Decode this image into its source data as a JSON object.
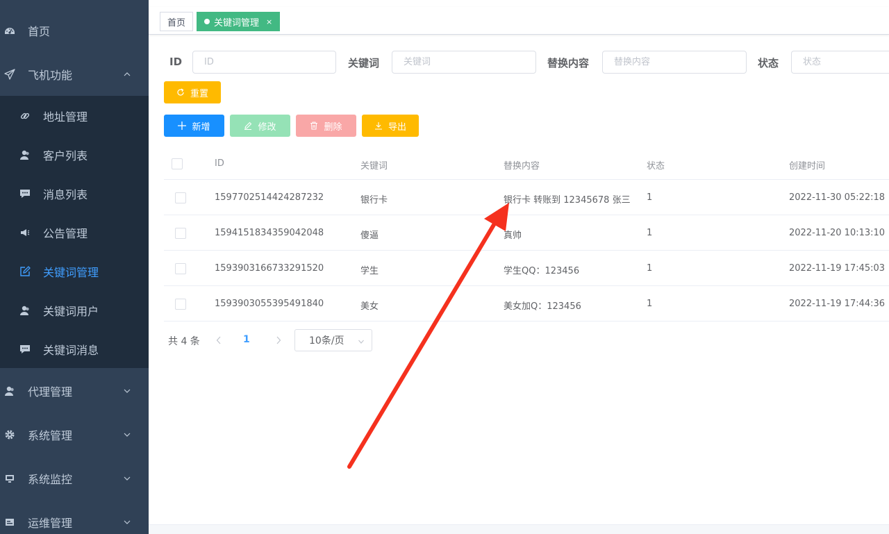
{
  "sidebar": {
    "top_items": [
      {
        "label": "首页",
        "icon": "dashboard-icon"
      },
      {
        "label": "飞机功能",
        "icon": "paper-plane-icon",
        "expanded": true
      },
      {
        "label": "代理管理",
        "icon": "user-icon"
      },
      {
        "label": "系统管理",
        "icon": "gear-icon"
      },
      {
        "label": "系统监控",
        "icon": "monitor-icon"
      },
      {
        "label": "运维管理",
        "icon": "tool-icon"
      }
    ],
    "sub_items": [
      {
        "label": "地址管理",
        "icon": "link-icon"
      },
      {
        "label": "客户列表",
        "icon": "user-icon"
      },
      {
        "label": "消息列表",
        "icon": "message-icon"
      },
      {
        "label": "公告管理",
        "icon": "megaphone-icon"
      },
      {
        "label": "关键词管理",
        "icon": "edit-icon",
        "active": true
      },
      {
        "label": "关键词用户",
        "icon": "user-icon"
      },
      {
        "label": "关键词消息",
        "icon": "message-icon"
      }
    ]
  },
  "tags": [
    {
      "label": "首页",
      "active": false
    },
    {
      "label": "关键词管理",
      "active": true,
      "close": "×"
    }
  ],
  "search": {
    "fields": [
      {
        "label": "ID",
        "placeholder": "ID"
      },
      {
        "label": "关键词",
        "placeholder": "关键词"
      },
      {
        "label": "替换内容",
        "placeholder": "替换内容"
      },
      {
        "label": "状态",
        "placeholder": "状态"
      }
    ],
    "reset_label": "重置"
  },
  "toolbar": {
    "add_label": "新增",
    "edit_label": "修改",
    "delete_label": "删除",
    "export_label": "导出"
  },
  "table": {
    "columns": [
      "ID",
      "关键词",
      "替换内容",
      "状态",
      "创建时间"
    ],
    "rows": [
      {
        "id": "1597702514424287232",
        "keyword": "银行卡",
        "replace": "银行卡 转账到 12345678 张三",
        "status": "1",
        "created": "2022-11-30 05:22:18"
      },
      {
        "id": "1594151834359042048",
        "keyword": "傻逼",
        "replace": "真帅",
        "status": "1",
        "created": "2022-11-20 10:13:10"
      },
      {
        "id": "1593903166733291520",
        "keyword": "学生",
        "replace": "学生QQ：123456",
        "status": "1",
        "created": "2022-11-19 17:45:03"
      },
      {
        "id": "1593903055395491840",
        "keyword": "美女",
        "replace": "美女加Q：123456",
        "status": "1",
        "created": "2022-11-19 17:44:36"
      }
    ]
  },
  "pagination": {
    "total_text": "共 4 条",
    "current_page": "1",
    "page_size": "10条/页"
  },
  "colors": {
    "sidebar_bg": "#304156",
    "submenu_bg": "#1f2d3d",
    "active_menu": "#409eff",
    "tag_active": "#42b983",
    "primary": "#1890ff",
    "success_disabled": "#95e2b6",
    "danger_disabled": "#f9a7a7",
    "warning": "#ffba00",
    "annotation_arrow": "#f5311e"
  }
}
